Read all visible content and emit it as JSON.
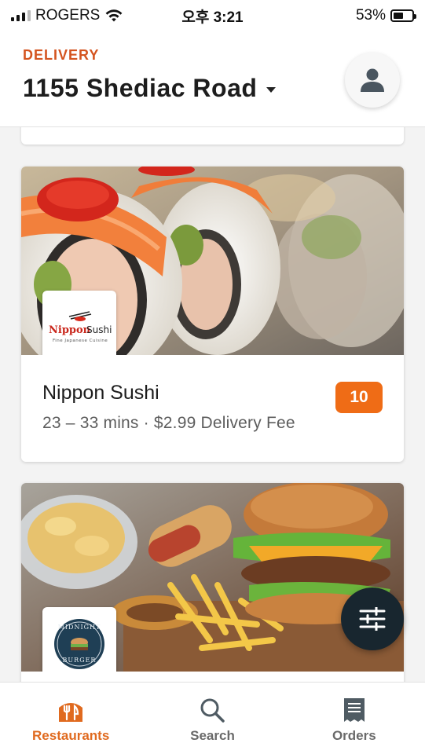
{
  "status_bar": {
    "carrier": "ROGERS",
    "time": "오후 3:21",
    "battery": "53%",
    "battery_level": 0.53
  },
  "header": {
    "mode_label": "DELIVERY",
    "address": "1155 Shediac Road"
  },
  "restaurants": [
    {
      "name": "Nippon Sushi",
      "delivery_time": "23 – 33 mins",
      "delivery_fee": "$2.99 Delivery Fee",
      "meta": "23 – 33 mins · $2.99 Delivery Fee",
      "badge": "10",
      "logo_text": "Nippon Sushi",
      "logo_subtext": "Fine Japanese Cuisine"
    },
    {
      "name": "Midnight Burger",
      "logo_text_top": "MIDNIGHT",
      "logo_text_bottom": "BURGER"
    }
  ],
  "bottom_nav": {
    "items": [
      {
        "label": "Restaurants",
        "icon": "restaurant-fork-knife-icon",
        "active": true
      },
      {
        "label": "Search",
        "icon": "search-icon",
        "active": false
      },
      {
        "label": "Orders",
        "icon": "receipt-icon",
        "active": false
      }
    ]
  },
  "colors": {
    "accent": "#d4541f",
    "badge": "#ef6c16",
    "fab": "#18262f",
    "nav_active": "#e06a1f"
  }
}
